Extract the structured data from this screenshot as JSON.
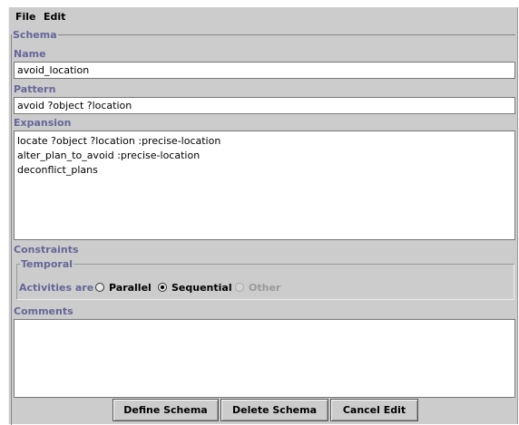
{
  "menu": {
    "file": "File",
    "edit": "Edit"
  },
  "schema": {
    "legend": "Schema",
    "name_label": "Name",
    "name_value": "avoid_location",
    "pattern_label": "Pattern",
    "pattern_value": "avoid ?object ?location",
    "expansion_label": "Expansion",
    "expansion_lines": [
      "locate ?object ?location :precise-location",
      "alter_plan_to_avoid :precise-location",
      "deconflict_plans"
    ],
    "constraints_label": "Constraints",
    "temporal": {
      "legend": "Temporal",
      "activities_label": "Activities are",
      "options": [
        {
          "label": "Parallel",
          "checked": false,
          "enabled": true
        },
        {
          "label": "Sequential",
          "checked": true,
          "enabled": true
        },
        {
          "label": "Other",
          "checked": false,
          "enabled": false
        }
      ]
    },
    "comments_label": "Comments",
    "comments_value": ""
  },
  "buttons": {
    "define": "Define Schema",
    "delete": "Delete Schema",
    "cancel": "Cancel Edit"
  },
  "colors": {
    "window_bg": "#cccccc",
    "label": "#666699"
  }
}
